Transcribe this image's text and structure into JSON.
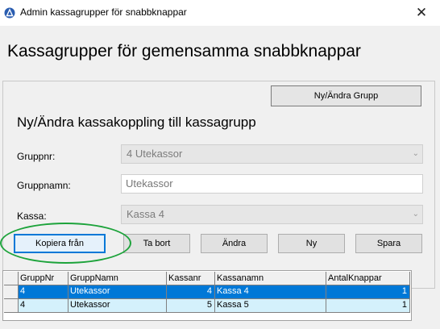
{
  "window": {
    "title": "Admin kassagrupper för snabbknappar",
    "close_glyph": "✕"
  },
  "heading": "Kassagrupper för gemensamma snabbknappar",
  "panel": {
    "ny_andra_grupp_button": "Ny/Ändra Grupp",
    "subheading": "Ny/Ändra kassakoppling till kassagrupp",
    "fields": {
      "gruppnr": {
        "label": "Gruppnr:",
        "value": "4  Utekassor"
      },
      "gruppnamn": {
        "label": "Gruppnamn:",
        "value": "Utekassor"
      },
      "kassa": {
        "label": "Kassa:",
        "value": "Kassa 4"
      }
    },
    "buttons": {
      "kopiera": "Kopiera från",
      "tabort": "Ta bort",
      "andra": "Ändra",
      "ny": "Ny",
      "spara": "Spara"
    }
  },
  "grid": {
    "columns": [
      "GruppNr",
      "GruppNamn",
      "Kassanr",
      "Kassanamn",
      "AntalKnappar"
    ],
    "rows": [
      {
        "gruppnr": "4",
        "gruppnamn": "Utekassor",
        "kassanr": "4",
        "kassanamn": "Kassa 4",
        "antal": "1",
        "selected": true
      },
      {
        "gruppnr": "4",
        "gruppnamn": "Utekassor",
        "kassanr": "5",
        "kassanamn": "Kassa 5",
        "antal": "1",
        "selected": false
      }
    ]
  },
  "colors": {
    "selection": "#0078d7",
    "row_alt": "#d4f1fc",
    "highlight_ring": "#1da33b"
  }
}
